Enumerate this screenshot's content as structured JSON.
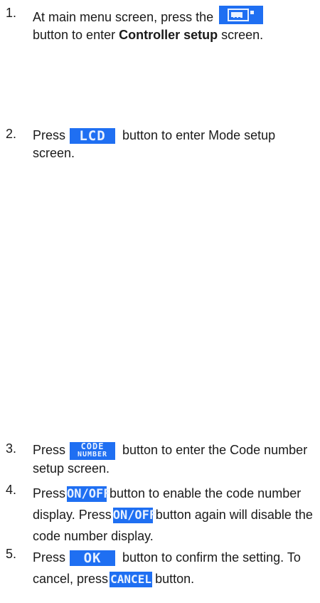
{
  "steps": [
    {
      "num": "1.",
      "part1": "At main menu screen, press the",
      "part2": "button to enter",
      "bold": "Controller setup",
      "part3": "screen."
    },
    {
      "num": "2.",
      "part1": "Press",
      "part2": "button to enter Mode setup screen."
    },
    {
      "num": "3.",
      "part1": "Press",
      "part2": "button to enter the Code number setup screen."
    },
    {
      "num": "4.",
      "part1": "Press",
      "part2": "button to enable the code number display. Press",
      "part3": "button again will disable the code number display."
    },
    {
      "num": "5.",
      "part1": "Press",
      "part2": "button to confirm the setting. To cancel, press",
      "part3": "button."
    }
  ],
  "buttons": {
    "lcd": "LCD",
    "code_line1": "CODE",
    "code_line2": "NUMBER",
    "onoff": "ON/OFF",
    "ok": "OK",
    "cancel": "CANCEL"
  },
  "colors": {
    "button_bg": "#1f6ff2",
    "button_text": "#e8f1ff"
  }
}
